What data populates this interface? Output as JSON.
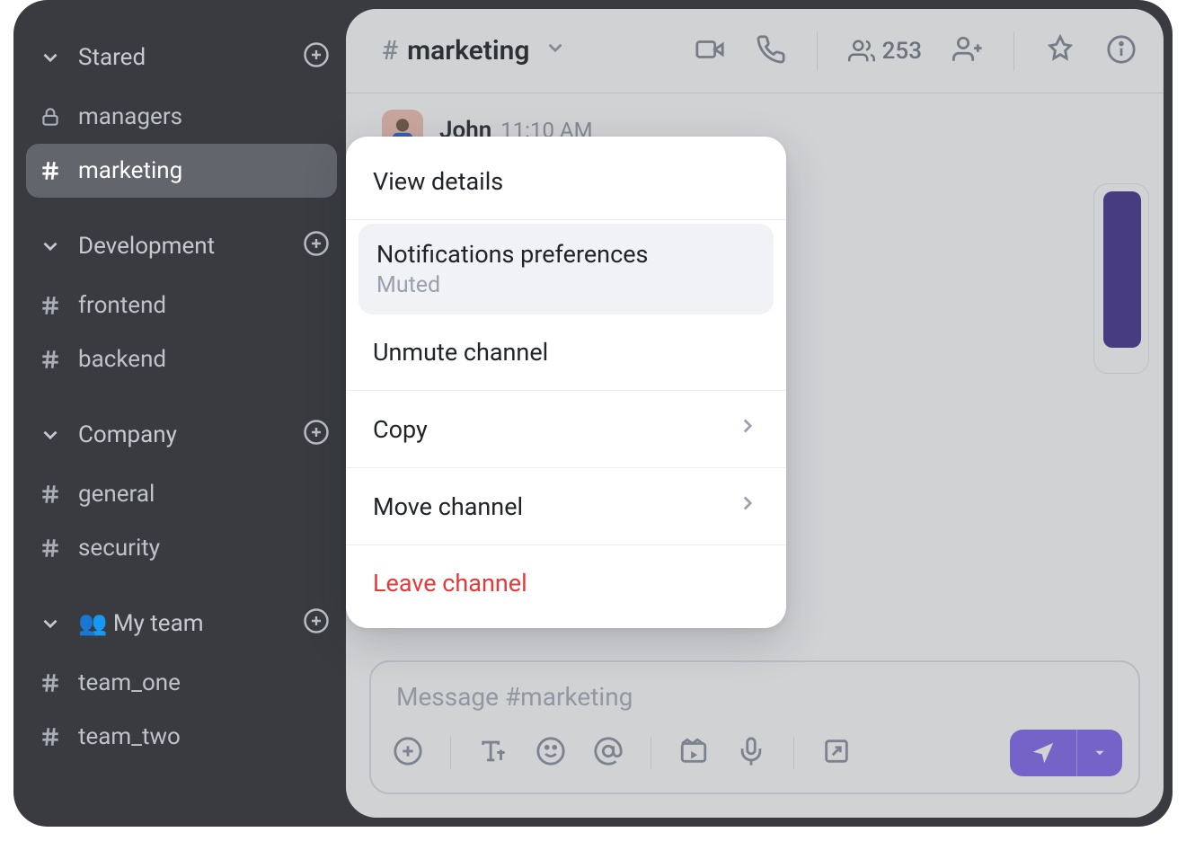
{
  "sidebar": {
    "groups": [
      {
        "title": "Stared",
        "has_add": true,
        "items": [
          {
            "icon": "lock",
            "label": "managers",
            "active": false
          },
          {
            "icon": "hash",
            "label": "marketing",
            "active": true
          }
        ]
      },
      {
        "title": "Development",
        "has_add": true,
        "items": [
          {
            "icon": "hash",
            "label": "frontend",
            "active": false
          },
          {
            "icon": "hash",
            "label": "backend",
            "active": false
          }
        ]
      },
      {
        "title": "Company",
        "has_add": true,
        "items": [
          {
            "icon": "hash",
            "label": "general",
            "active": false
          },
          {
            "icon": "hash",
            "label": "security",
            "active": false
          }
        ]
      },
      {
        "title": "👥 My team",
        "has_add": true,
        "items": [
          {
            "icon": "hash",
            "label": "team_one",
            "active": false
          },
          {
            "icon": "hash",
            "label": "team_two",
            "active": false
          }
        ]
      }
    ]
  },
  "channel": {
    "hash": "#",
    "name": "marketing",
    "member_count": "253"
  },
  "message": {
    "author": "John",
    "time": "11:10 AM"
  },
  "composer": {
    "placeholder": "Message #marketing"
  },
  "menu": {
    "view_details": "View details",
    "notif_pref": "Notifications preferences",
    "notif_state": "Muted",
    "unmute": "Unmute channel",
    "copy": "Copy",
    "move": "Move channel",
    "leave": "Leave channel"
  }
}
